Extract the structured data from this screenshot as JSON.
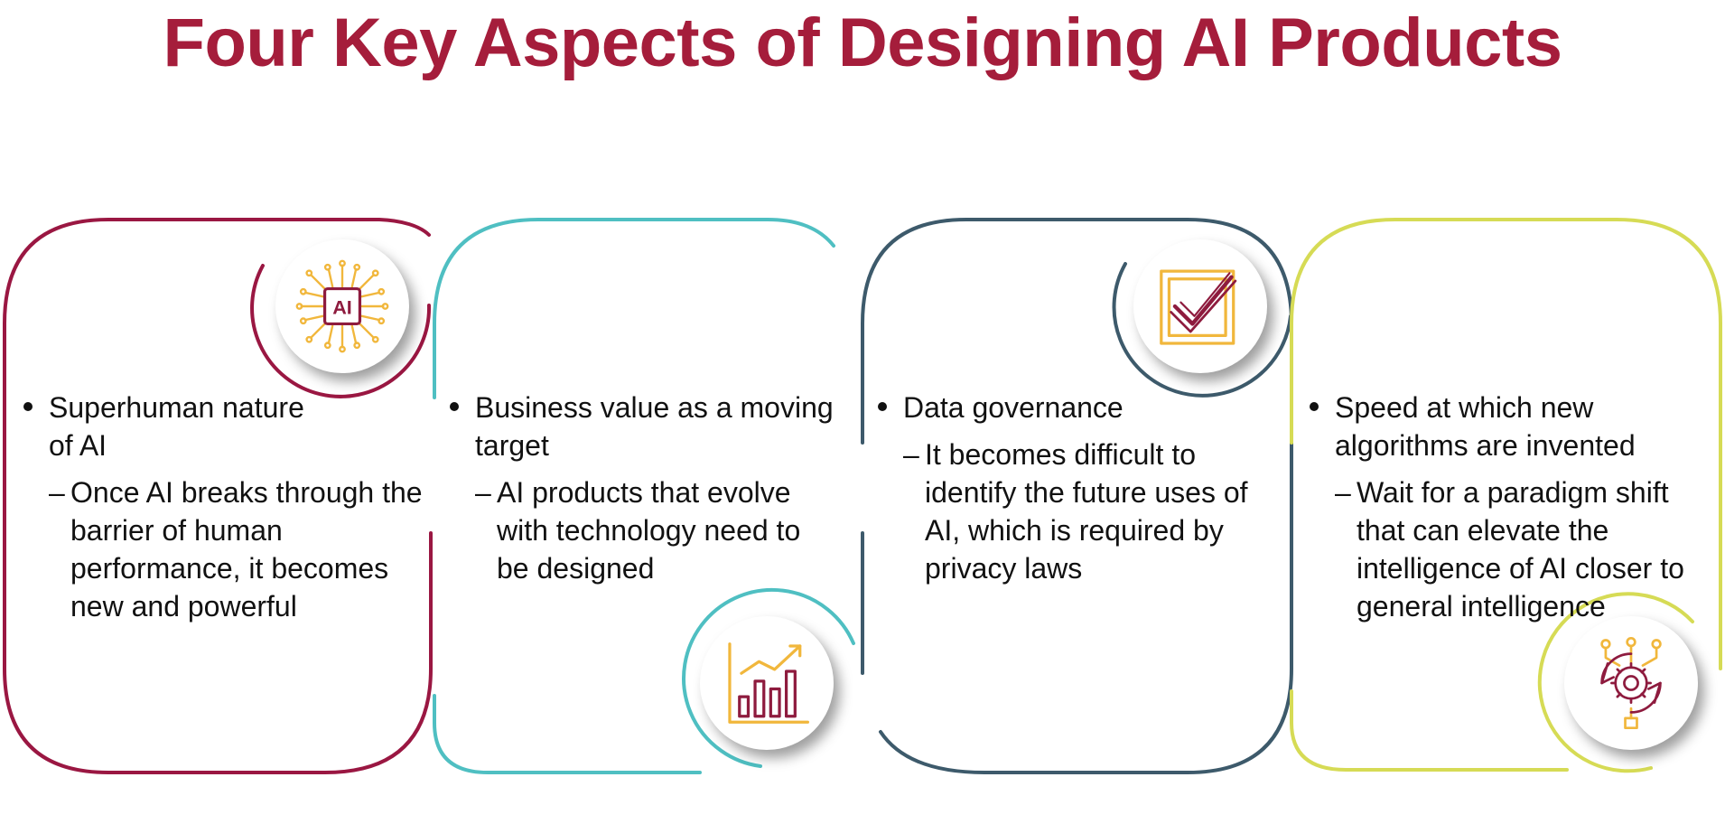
{
  "title": "Four Key Aspects of Designing AI Products",
  "colors": {
    "title": "#A51D3B",
    "card1": "#9A1742",
    "card2": "#4FBFC2",
    "card3": "#3D5A6B",
    "card4": "#D6DB55",
    "icon_gold": "#F1B73C",
    "icon_maroon": "#8E1B3E"
  },
  "cards": [
    {
      "icon": "ai-chip-icon",
      "point": "Superhuman nature of AI",
      "sub": "Once AI breaks through the barrier of human performance, it becomes new and powerful"
    },
    {
      "icon": "growth-chart-icon",
      "point": "Business value as a moving target",
      "sub": "AI products that evolve with technology need to be designed"
    },
    {
      "icon": "checkmark-icon",
      "point": "Data governance",
      "sub": "It becomes difficult to identify the future uses of AI, which is required by privacy laws"
    },
    {
      "icon": "gear-network-icon",
      "point": "Speed at which new algorithms are invented",
      "sub": "Wait for a paradigm shift that can elevate the intelligence of AI closer to general intelligence"
    }
  ],
  "dash": "–"
}
